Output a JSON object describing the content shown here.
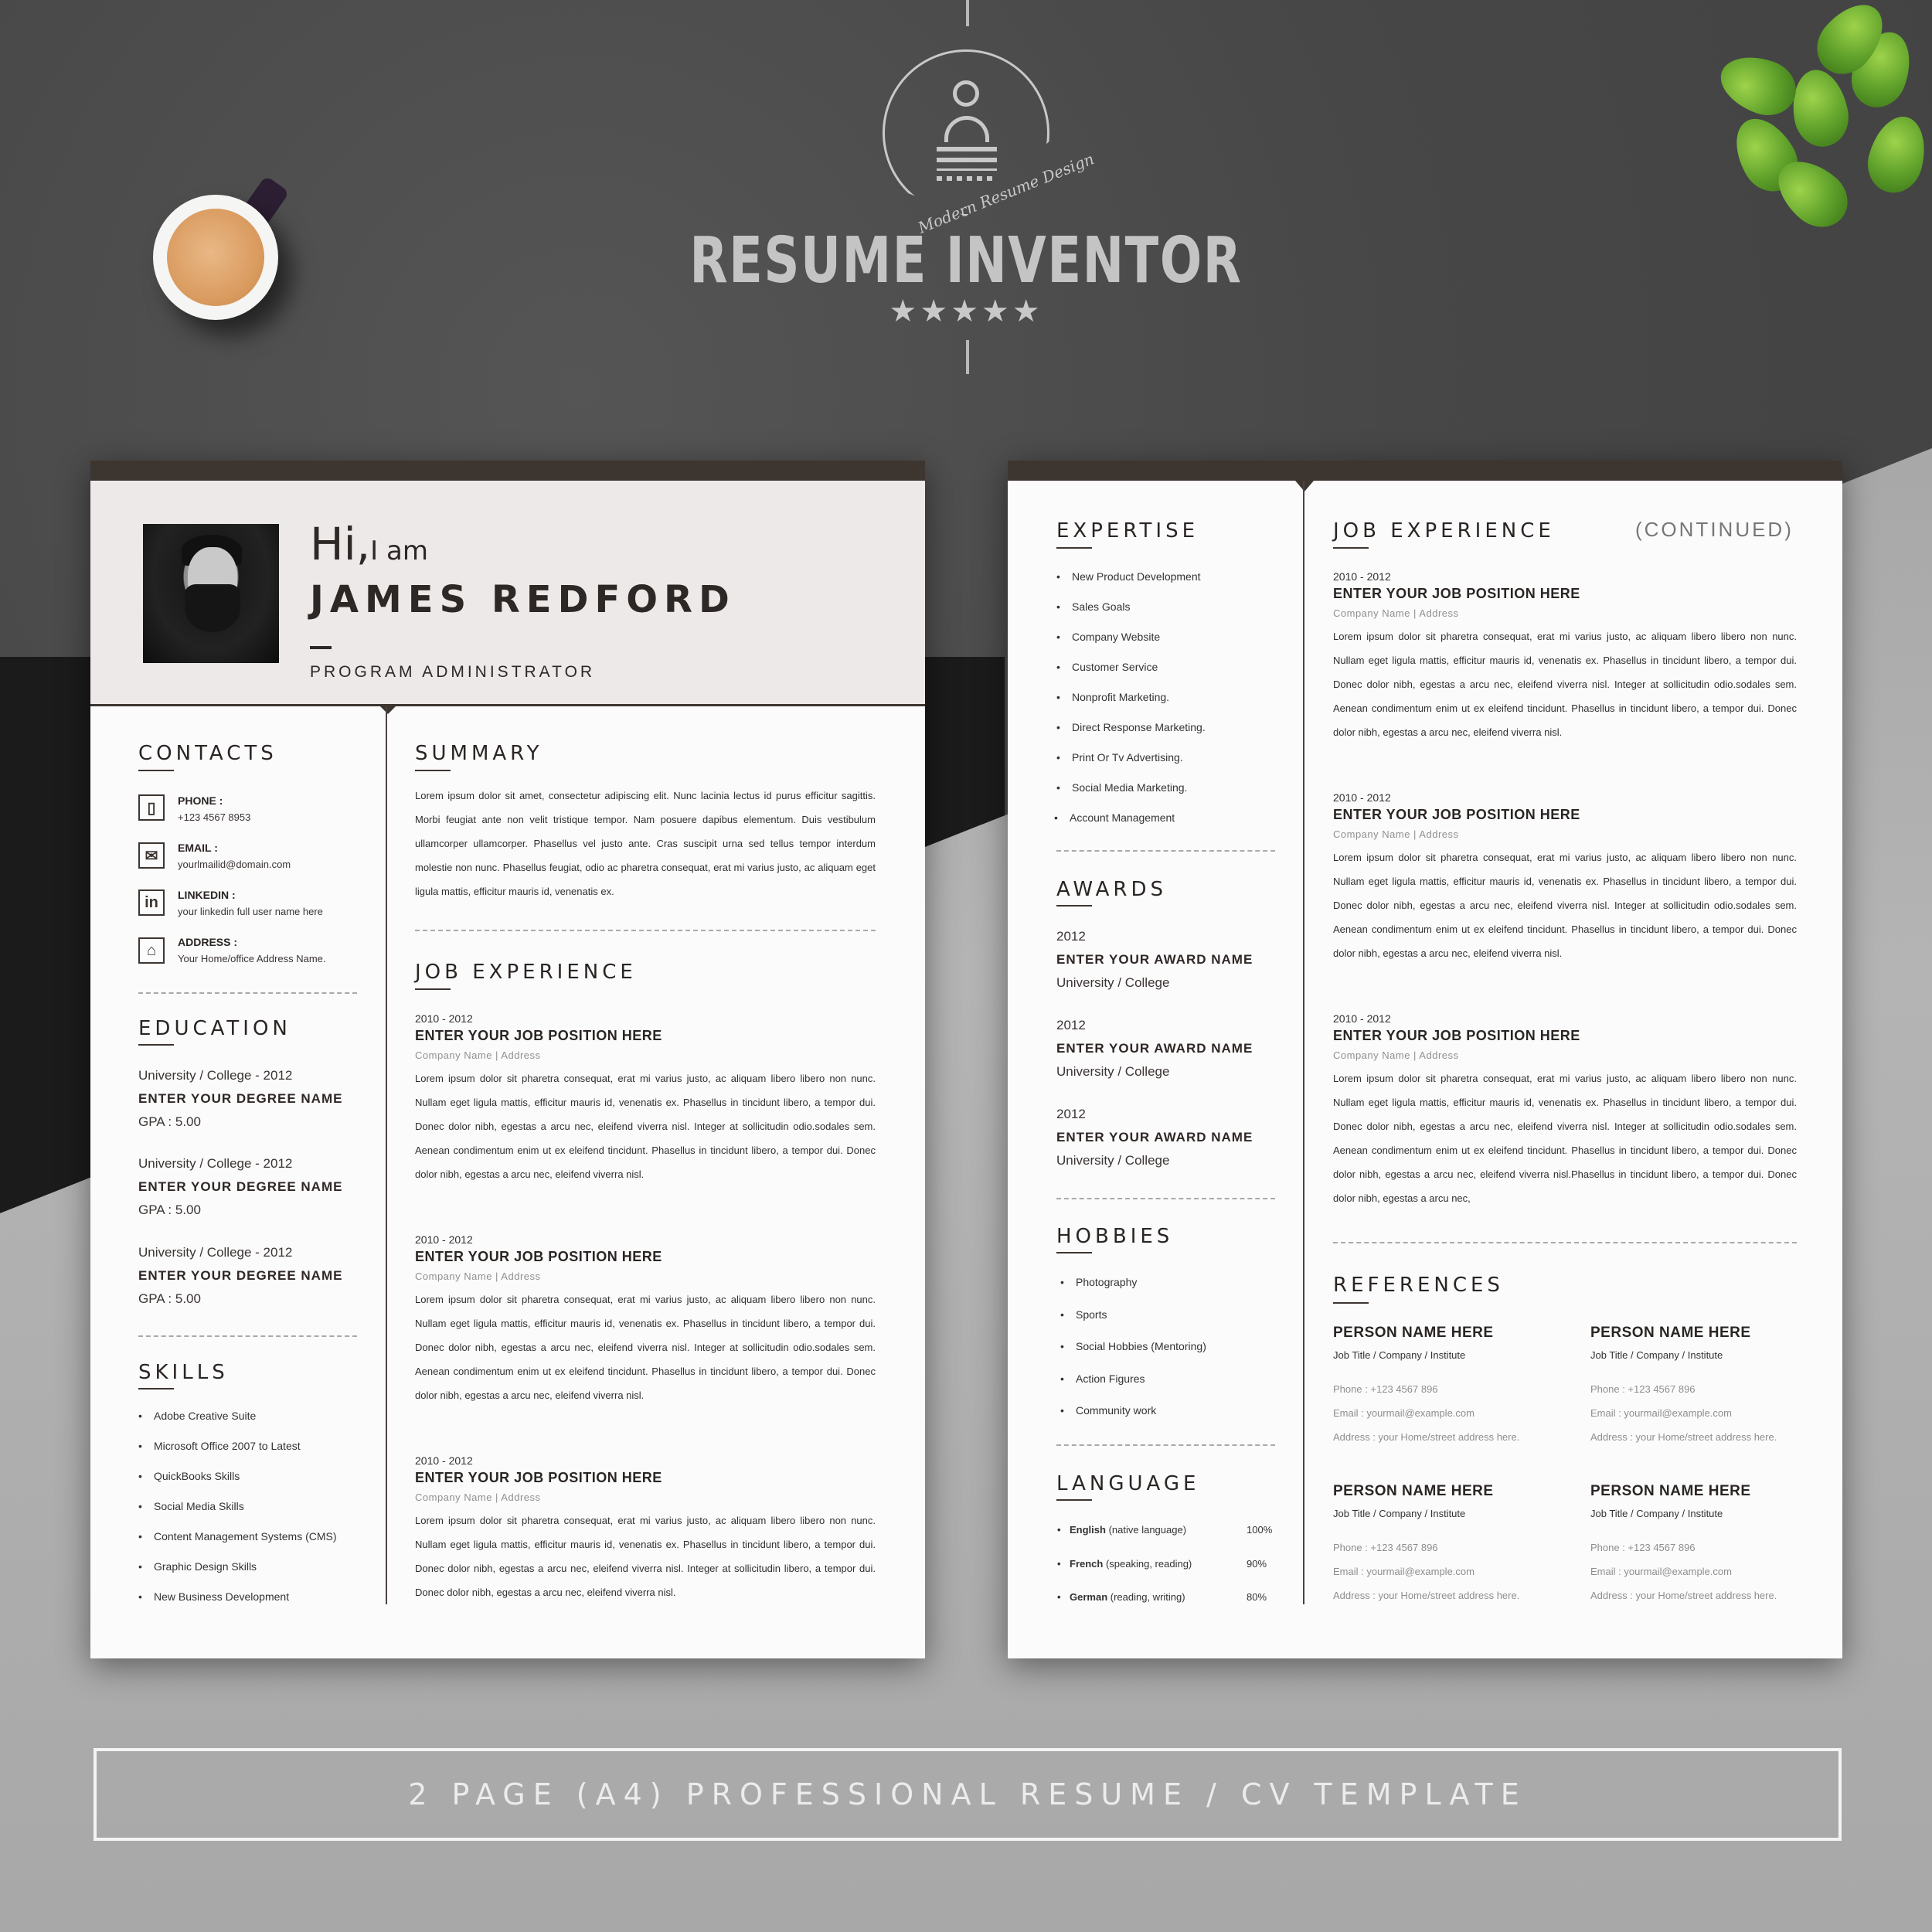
{
  "brand": {
    "name": "RESUME INVENTOR",
    "tagline": "Modern Resume Design",
    "rating_stars": 5,
    "stars_text": "★★★★★"
  },
  "banner": {
    "text": "2 PAGE (A4) PROFESSIONAL RESUME / CV TEMPLATE"
  },
  "page1": {
    "header": {
      "greeting_hi": "Hi,",
      "greeting_iam": "I am",
      "name": "JAMES REDFORD",
      "title": "PROGRAM ADMINISTRATOR"
    },
    "contacts": {
      "title": "CONTACTS",
      "items": [
        {
          "icon": "phone-icon",
          "glyph": "▯",
          "label": "PHONE :",
          "value": "+123 4567 8953"
        },
        {
          "icon": "email-icon",
          "glyph": "✉",
          "label": "EMAIL :",
          "value": "yourlmailid@domain.com"
        },
        {
          "icon": "linkedin-icon",
          "glyph": "in",
          "label": "LINKEDIN :",
          "value": "your linkedin full user name here"
        },
        {
          "icon": "home-icon",
          "glyph": "⌂",
          "label": "ADDRESS :",
          "value": "Your Home/office Address Name."
        }
      ]
    },
    "education": {
      "title": "EDUCATION",
      "items": [
        {
          "school": "University / College - 2012",
          "degree": "ENTER YOUR DEGREE NAME",
          "gpa": "GPA : 5.00"
        },
        {
          "school": "University / College - 2012",
          "degree": "ENTER YOUR DEGREE NAME",
          "gpa": "GPA : 5.00"
        },
        {
          "school": "University / College - 2012",
          "degree": "ENTER YOUR DEGREE NAME",
          "gpa": "GPA : 5.00"
        }
      ]
    },
    "skills": {
      "title": "SKILLS",
      "items": [
        "Adobe Creative Suite",
        "Microsoft Office 2007 to Latest",
        "QuickBooks Skills",
        "Social Media Skills",
        "Content Management Systems (CMS)",
        "Graphic Design Skills",
        "New Business Development"
      ]
    },
    "summary": {
      "title": "SUMMARY",
      "text": "Lorem ipsum dolor sit amet, consectetur adipiscing elit. Nunc lacinia lectus id purus efficitur sagittis. Morbi feugiat ante non velit tristique tempor. Nam posuere dapibus elementum. Duis vestibulum ullamcorper ullamcorper. Phasellus vel justo ante. Cras suscipit urna sed tellus tempor interdum molestie non nunc. Phasellus feugiat, odio ac pharetra consequat, erat mi varius justo, ac aliquam eget ligula mattis, efficitur mauris id, venenatis ex."
    },
    "experience": {
      "title": "JOB EXPERIENCE",
      "items": [
        {
          "dates": "2010 - 2012",
          "position": "ENTER YOUR JOB POSITION HERE",
          "company": "Company Name |  Address",
          "desc": "Lorem ipsum dolor sit pharetra consequat, erat mi varius justo, ac aliquam libero libero non nunc. Nullam eget ligula mattis, efficitur mauris id, venenatis ex. Phasellus in tincidunt libero, a tempor dui. Donec dolor nibh, egestas a arcu nec, eleifend viverra nisl. Integer at sollicitudin odio.sodales sem. Aenean condimentum enim ut ex eleifend tincidunt. Phasellus in tincidunt libero, a tempor dui. Donec dolor nibh, egestas a arcu nec, eleifend viverra nisl."
        },
        {
          "dates": "2010 - 2012",
          "position": "ENTER YOUR JOB POSITION HERE",
          "company": "Company Name |  Address",
          "desc": "Lorem ipsum dolor sit pharetra consequat, erat mi varius justo, ac aliquam libero libero non nunc. Nullam eget ligula mattis, efficitur mauris id, venenatis ex. Phasellus in tincidunt libero, a tempor dui. Donec dolor nibh, egestas a arcu nec, eleifend viverra nisl. Integer at sollicitudin odio.sodales sem. Aenean condimentum enim ut ex eleifend tincidunt. Phasellus in tincidunt libero, a tempor dui. Donec dolor nibh, egestas a arcu nec, eleifend viverra nisl."
        },
        {
          "dates": "2010 - 2012",
          "position": "ENTER YOUR JOB POSITION HERE",
          "company": "Company Name |  Address",
          "desc": "Lorem ipsum dolor sit pharetra consequat, erat mi varius justo, ac aliquam libero libero non nunc. Nullam eget ligula mattis, efficitur mauris id, venenatis ex. Phasellus in tincidunt libero, a tempor dui. Donec dolor nibh, egestas a arcu nec, eleifend viverra nisl. Integer at sollicitudin libero, a tempor dui. Donec dolor nibh, egestas a arcu nec, eleifend viverra nisl."
        }
      ]
    }
  },
  "page2": {
    "expertise": {
      "title": "EXPERTISE",
      "items": [
        "New Product Development",
        "Sales Goals",
        "Company Website",
        "Customer Service",
        "Nonprofit Marketing.",
        "Direct Response Marketing.",
        "Print Or Tv Advertising.",
        "Social Media Marketing.",
        "Account Management"
      ]
    },
    "awards": {
      "title": "AWARDS",
      "items": [
        {
          "year": "2012",
          "name": "ENTER YOUR AWARD NAME",
          "org": "University / College"
        },
        {
          "year": "2012",
          "name": "ENTER YOUR AWARD NAME",
          "org": "University / College"
        },
        {
          "year": "2012",
          "name": "ENTER YOUR AWARD NAME",
          "org": "University / College"
        }
      ]
    },
    "hobbies": {
      "title": "HOBBIES",
      "items": [
        "Photography",
        "Sports",
        "Social Hobbies (Mentoring)",
        "Action Figures",
        "Community work"
      ]
    },
    "language": {
      "title": "LANGUAGE",
      "items": [
        {
          "name": "English",
          "note": "(native language)",
          "level": "100%"
        },
        {
          "name": "French",
          "note": "(speaking, reading)",
          "level": "90%"
        },
        {
          "name": "German",
          "note": "(reading, writing)",
          "level": "80%"
        }
      ]
    },
    "experience": {
      "title": "JOB EXPERIENCE",
      "continued": "(CONTINUED)",
      "items": [
        {
          "dates": "2010 - 2012",
          "position": "ENTER YOUR JOB POSITION HERE",
          "company": "Company Name |  Address",
          "desc": "Lorem ipsum dolor sit pharetra consequat, erat mi varius justo, ac aliquam libero libero non nunc. Nullam eget ligula mattis, efficitur mauris id, venenatis ex. Phasellus in tincidunt libero, a tempor dui. Donec dolor nibh, egestas a arcu nec, eleifend viverra nisl. Integer at sollicitudin odio.sodales sem. Aenean condimentum enim ut ex eleifend tincidunt. Phasellus in tincidunt libero, a tempor dui. Donec dolor nibh, egestas a arcu nec, eleifend viverra nisl."
        },
        {
          "dates": "2010 - 2012",
          "position": "ENTER YOUR JOB POSITION HERE",
          "company": "Company Name |  Address",
          "desc": "Lorem ipsum dolor sit pharetra consequat, erat mi varius justo, ac aliquam libero libero non nunc. Nullam eget ligula mattis, efficitur mauris id, venenatis ex. Phasellus in tincidunt libero, a tempor dui. Donec dolor nibh, egestas a arcu nec, eleifend viverra nisl. Integer at sollicitudin odio.sodales sem. Aenean condimentum enim ut ex eleifend tincidunt. Phasellus in tincidunt libero, a tempor dui. Donec dolor nibh, egestas a arcu nec, eleifend viverra nisl."
        },
        {
          "dates": "2010 - 2012",
          "position": "ENTER YOUR JOB POSITION HERE",
          "company": "Company Name |  Address",
          "desc": "Lorem ipsum dolor sit pharetra consequat, erat mi varius justo, ac aliquam libero libero non nunc. Nullam eget ligula mattis, efficitur mauris id, venenatis ex. Phasellus in tincidunt libero, a tempor dui. Donec dolor nibh, egestas a arcu nec, eleifend viverra nisl. Integer at sollicitudin odio.sodales sem. Aenean condimentum enim ut ex eleifend tincidunt. Phasellus in tincidunt libero, a tempor dui. Donec dolor nibh, egestas a arcu nec, eleifend viverra nisl.Phasellus in tincidunt libero, a tempor dui. Donec dolor nibh, egestas a arcu nec,"
        }
      ]
    },
    "references": {
      "title": "REFERENCES",
      "items": [
        {
          "name": "PERSON NAME HERE",
          "title": "Job Title / Company / Institute",
          "phone": "Phone  :  +123 4567 896",
          "email": "Email  :  yourmail@example.com",
          "address": "Address : your Home/street address here."
        },
        {
          "name": "PERSON NAME HERE",
          "title": "Job Title / Company / Institute",
          "phone": "Phone  :  +123 4567 896",
          "email": "Email  :  yourmail@example.com",
          "address": "Address : your Home/street address here."
        },
        {
          "name": "PERSON NAME HERE",
          "title": "Job Title / Company / Institute",
          "phone": "Phone  :  +123 4567 896",
          "email": "Email  :  yourmail@example.com",
          "address": "Address : your Home/street address here."
        },
        {
          "name": "PERSON NAME HERE",
          "title": "Job Title / Company / Institute",
          "phone": "Phone  :  +123 4567 896",
          "email": "Email  :  yourmail@example.com",
          "address": "Address : your Home/street address here."
        }
      ]
    }
  },
  "colors": {
    "accent_dark": "#3d3530",
    "header_bg": "#ede9e8",
    "page_bg": "#fbfbfb",
    "muted_text": "#909090"
  }
}
